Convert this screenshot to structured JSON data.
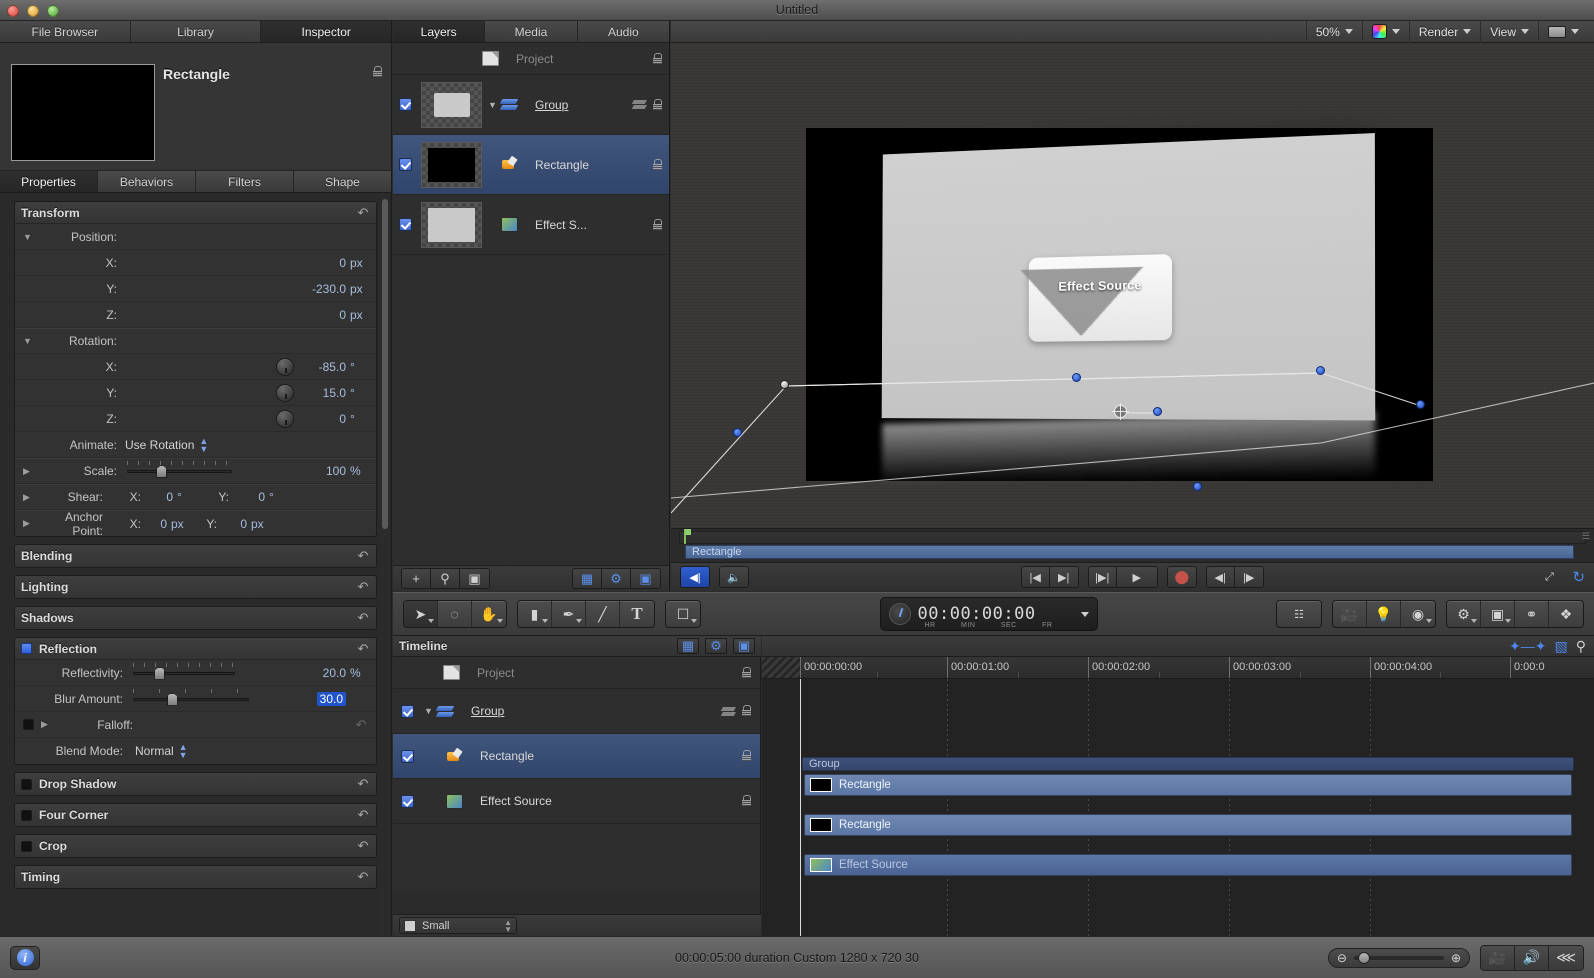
{
  "window": {
    "title": "Untitled"
  },
  "left_tabs": [
    {
      "label": "File Browser",
      "active": false
    },
    {
      "label": "Library",
      "active": false
    },
    {
      "label": "Inspector",
      "active": true
    }
  ],
  "inspector": {
    "object_name": "Rectangle",
    "lock_icon": "lock-icon",
    "tabs": [
      {
        "label": "Properties",
        "active": true
      },
      {
        "label": "Behaviors",
        "active": false
      },
      {
        "label": "Filters",
        "active": false
      },
      {
        "label": "Shape",
        "active": false
      }
    ],
    "transform": {
      "title": "Transform",
      "position": {
        "label": "Position:",
        "x_label": "X:",
        "x_value": "0",
        "x_unit": "px",
        "y_label": "Y:",
        "y_value": "-230.0",
        "y_unit": "px",
        "z_label": "Z:",
        "z_value": "0",
        "z_unit": "px"
      },
      "rotation": {
        "label": "Rotation:",
        "x_label": "X:",
        "x_value": "-85.0",
        "x_unit": "°",
        "y_label": "Y:",
        "y_value": "15.0",
        "y_unit": "°",
        "z_label": "Z:",
        "z_value": "0",
        "z_unit": "°"
      },
      "animate": {
        "label": "Animate:",
        "value": "Use Rotation"
      },
      "scale": {
        "label": "Scale:",
        "value": "100",
        "unit": "%"
      },
      "shear": {
        "label": "Shear:",
        "x_label": "X:",
        "x_value": "0",
        "x_unit": "°",
        "y_label": "Y:",
        "y_value": "0",
        "y_unit": "°"
      },
      "anchor": {
        "label": "Anchor Point:",
        "x_label": "X:",
        "x_value": "0",
        "x_unit": "px",
        "y_label": "Y:",
        "y_value": "0",
        "y_unit": "px"
      }
    },
    "blending": {
      "title": "Blending"
    },
    "lighting": {
      "title": "Lighting"
    },
    "shadows": {
      "title": "Shadows"
    },
    "reflection": {
      "title": "Reflection",
      "enabled": true,
      "reflectivity": {
        "label": "Reflectivity:",
        "value": "20.0",
        "unit": "%"
      },
      "blur": {
        "label": "Blur Amount:",
        "value": "30.0"
      },
      "falloff": {
        "label": "Falloff:"
      },
      "blend_mode": {
        "label": "Blend Mode:",
        "value": "Normal"
      }
    },
    "drop_shadow": {
      "title": "Drop Shadow"
    },
    "four_corner": {
      "title": "Four Corner"
    },
    "crop": {
      "title": "Crop"
    },
    "timing": {
      "title": "Timing"
    }
  },
  "layers_panel": {
    "tabs": [
      {
        "label": "Layers",
        "active": true
      },
      {
        "label": "Media",
        "active": false
      },
      {
        "label": "Audio",
        "active": false
      }
    ],
    "rows": [
      {
        "name": "Project",
        "type": "project",
        "checked": false,
        "selected": false
      },
      {
        "name": "Group",
        "type": "group",
        "checked": true,
        "selected": false,
        "underline": true
      },
      {
        "name": "Rectangle",
        "type": "shape",
        "checked": true,
        "selected": true
      },
      {
        "name": "Effect S...",
        "type": "image",
        "checked": true,
        "selected": false
      }
    ],
    "toolbar": {
      "add": "+",
      "search": "search-icon",
      "mask": "mask-icon",
      "view_left": "checkerboard-icon",
      "view_mid": "gear-icon",
      "view_right": "filmstrip-icon"
    }
  },
  "canvas_toolbar": {
    "zoom": "50%",
    "color_label": "color-wheel-icon",
    "render": "Render",
    "view": "View",
    "layout": "layout-icon"
  },
  "canvas": {
    "effect_source_label": "Effect Source"
  },
  "mini_timeline": {
    "clip_label": "Rectangle"
  },
  "transport": {
    "buttons": [
      "go-to-start",
      "play-range-start",
      "previous-keyframe",
      "next-keyframe",
      "jump-to-start",
      "play",
      "record",
      "step-back",
      "step-forward"
    ],
    "loop": "loop-icon"
  },
  "timecode": {
    "value": "00:00:00:00",
    "units": [
      "HR",
      "MIN",
      "SEC",
      "FR"
    ]
  },
  "tools": {
    "select": "arrow-icon",
    "transform3d": "3d-transform-icon",
    "pan": "hand-icon",
    "rectangle": "rectangle-icon",
    "bezier": "bezier-pen-icon",
    "paint": "paint-stroke-icon",
    "text": "T",
    "mask": "mask-rect-icon",
    "inspector_hud": "hud-icon",
    "camera": "camera-icon",
    "light": "light-icon",
    "reflect": "reflect-icon",
    "behaviors": "gear-icon",
    "filmstrip": "filmstrip-icon",
    "keying": "keying-icon",
    "dots": "dots-icon"
  },
  "timeline": {
    "title": "Timeline",
    "header_icons": [
      "checkerboard-icon",
      "gear-icon",
      "filmstrip-icon"
    ],
    "right_icons": [
      "keyframe-icon",
      "marker-icon",
      "zoom-icon"
    ],
    "rows": [
      {
        "name": "Project",
        "type": "project",
        "checked": false,
        "selected": false
      },
      {
        "name": "Group",
        "type": "group",
        "checked": true,
        "selected": false,
        "underline": true
      },
      {
        "name": "Rectangle",
        "type": "shape",
        "checked": true,
        "selected": true
      },
      {
        "name": "Effect Source",
        "type": "image",
        "checked": true,
        "selected": false
      }
    ],
    "ruler_ticks": [
      "00:00:00:00",
      "00:00:01:00",
      "00:00:02:00",
      "00:00:03:00",
      "00:00:04:00",
      "0:00:0"
    ],
    "clips": [
      {
        "label": "Group",
        "kind": "group"
      },
      {
        "label": "Rectangle",
        "kind": "layer",
        "swatch": "black"
      },
      {
        "label": "Rectangle",
        "kind": "layer",
        "swatch": "black"
      },
      {
        "label": "Effect Source",
        "kind": "layer",
        "swatch": "image"
      }
    ],
    "footer": {
      "size_label": "Small"
    }
  },
  "statusbar": {
    "info_icon": "info-icon",
    "text": "00:00:05:00 duration Custom 1280 x 720 30",
    "zoom_out_icon": "zoom-out-icon",
    "zoom_in_icon": "zoom-in-icon",
    "buttons": [
      "video-icon",
      "audio-icon",
      "rewind-icon"
    ]
  }
}
